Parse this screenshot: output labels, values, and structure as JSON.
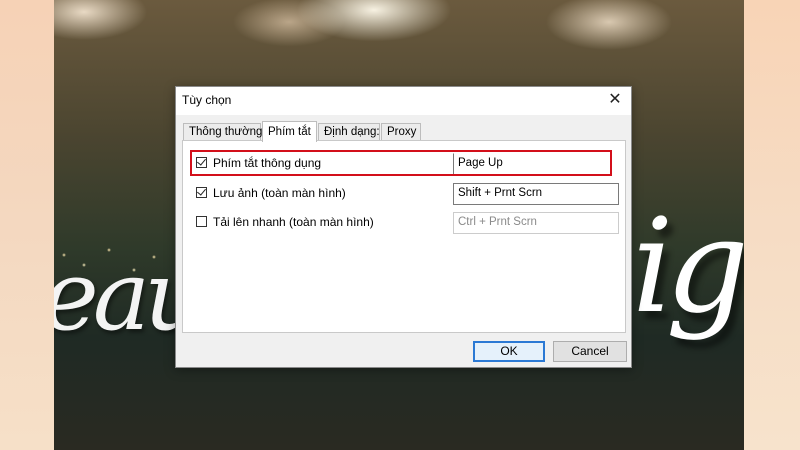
{
  "background": {
    "script_text_left": "eau",
    "script_text_right": "ig"
  },
  "dialog": {
    "title": "Tùy chọn",
    "close_glyph": "✕",
    "tabs": [
      {
        "label": "Thông thường",
        "active": false
      },
      {
        "label": "Phím tắt",
        "active": true
      },
      {
        "label": "Định dạng:",
        "active": false
      },
      {
        "label": "Proxy",
        "active": false
      }
    ],
    "rows": [
      {
        "label": "Phím tắt thông dụng",
        "checked": true,
        "value": "Page Up",
        "enabled": true
      },
      {
        "label": "Lưu ảnh (toàn màn hình)",
        "checked": true,
        "value": "Shift + Prnt Scrn",
        "enabled": true
      },
      {
        "label": "Tải lên nhanh (toàn màn hình)",
        "checked": false,
        "value": "Ctrl + Prnt Scrn",
        "enabled": false
      }
    ],
    "buttons": {
      "ok": "OK",
      "cancel": "Cancel"
    }
  },
  "colors": {
    "highlight": "#d30f1a",
    "ok_border": "#2b79d4"
  }
}
